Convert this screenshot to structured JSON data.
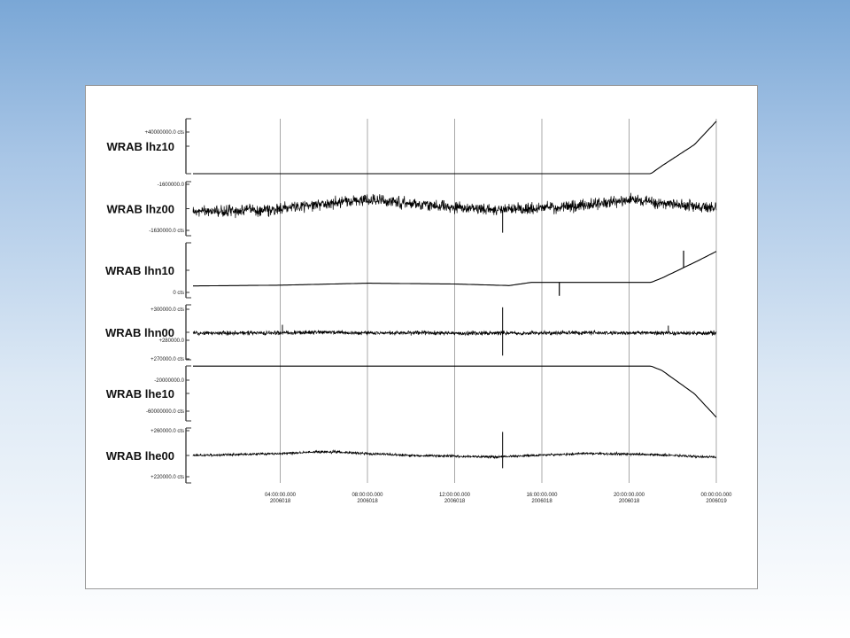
{
  "colors": {
    "background_top": "#7aa7d6",
    "background_bottom": "#ffffff",
    "panel": "#ffffff",
    "trace": "#000000",
    "gridline": "#a8a8a8"
  },
  "chart_data": {
    "type": "line",
    "grid": true,
    "time_axis": {
      "ticks": [
        {
          "time": "04:00:00.000",
          "date": "2006018"
        },
        {
          "time": "08:00:00.000",
          "date": "2006018"
        },
        {
          "time": "12:00:00.000",
          "date": "2006018"
        },
        {
          "time": "16:00:00.000",
          "date": "2006018"
        },
        {
          "time": "20:00:00.000",
          "date": "2006018"
        },
        {
          "time": "00:00:00.000",
          "date": "2006019"
        }
      ],
      "range_hours": [
        0,
        24
      ]
    },
    "traces": [
      {
        "name": "WRAB lhz10",
        "style": "line",
        "tick_labels": [
          "+40000000.0 cts"
        ],
        "ylim": [
          -40000000,
          45000000
        ],
        "points": [
          [
            0,
            -40000000
          ],
          [
            21,
            -40000000
          ],
          [
            21.5,
            -28000000
          ],
          [
            23,
            5000000
          ],
          [
            24,
            41000000
          ]
        ]
      },
      {
        "name": "WRAB lhz00",
        "style": "noise",
        "tick_labels": [
          "-1600000.0",
          "-1630000.0 cts"
        ],
        "ylim": [
          -1633000,
          -1597000
        ],
        "noise": 5500,
        "spikes": [
          [
            14.2,
            -1631000
          ]
        ],
        "points": [
          [
            0,
            -1617000
          ],
          [
            3,
            -1616000
          ],
          [
            8,
            -1609000
          ],
          [
            11,
            -1613000
          ],
          [
            14,
            -1616000
          ],
          [
            17,
            -1614000
          ],
          [
            20,
            -1609000
          ],
          [
            24,
            -1615000
          ]
        ]
      },
      {
        "name": "WRAB lhn10",
        "style": "line",
        "tick_labels": [
          "0 cts"
        ],
        "ylim": [
          -2000000,
          12000000
        ],
        "spikes": [
          [
            16.8,
            -1500000
          ],
          [
            22.5,
            10000000
          ]
        ],
        "points": [
          [
            0,
            1000000
          ],
          [
            4,
            1200000
          ],
          [
            8,
            1700000
          ],
          [
            12,
            1500000
          ],
          [
            14.5,
            1100000
          ],
          [
            15.5,
            1900000
          ],
          [
            17,
            1900000
          ],
          [
            21,
            1900000
          ],
          [
            21.5,
            3000000
          ],
          [
            23,
            7000000
          ],
          [
            24,
            9800000
          ]
        ]
      },
      {
        "name": "WRAB lhn00",
        "style": "noise",
        "tick_labels": [
          "+300000.0 cts",
          "+280000.0",
          "+270000.0 cts"
        ],
        "ylim": [
          268000,
          301000
        ],
        "noise": 1800,
        "spikes": [
          [
            14.2,
            299500
          ],
          [
            14.2,
            270500
          ],
          [
            4.1,
            289000
          ],
          [
            21.8,
            288500
          ]
        ],
        "points": [
          [
            0,
            284000
          ],
          [
            6,
            284300
          ],
          [
            12,
            284000
          ],
          [
            18,
            284200
          ],
          [
            24,
            284000
          ]
        ]
      },
      {
        "name": "WRAB lhe10",
        "style": "line",
        "tick_labels": [
          "-20000000.0",
          "-60000000.0 cts"
        ],
        "ylim": [
          -75000000,
          0
        ],
        "points": [
          [
            0,
            -200000
          ],
          [
            16,
            -200000
          ],
          [
            21,
            -200000
          ],
          [
            21.5,
            -6000000
          ],
          [
            23,
            -38000000
          ],
          [
            24,
            -70000000
          ]
        ]
      },
      {
        "name": "WRAB lhe00",
        "style": "noise",
        "tick_labels": [
          "+260000.0 cts",
          "+220000.0 cts"
        ],
        "ylim": [
          212000,
          268000
        ],
        "noise": 1900,
        "spikes": [
          [
            14.2,
            264000
          ],
          [
            14.2,
            227000
          ]
        ],
        "points": [
          [
            0,
            240000
          ],
          [
            4,
            242000
          ],
          [
            6,
            244000
          ],
          [
            10,
            240000
          ],
          [
            14,
            238500
          ],
          [
            18,
            242000
          ],
          [
            21,
            241000
          ],
          [
            24,
            238000
          ]
        ]
      }
    ]
  }
}
